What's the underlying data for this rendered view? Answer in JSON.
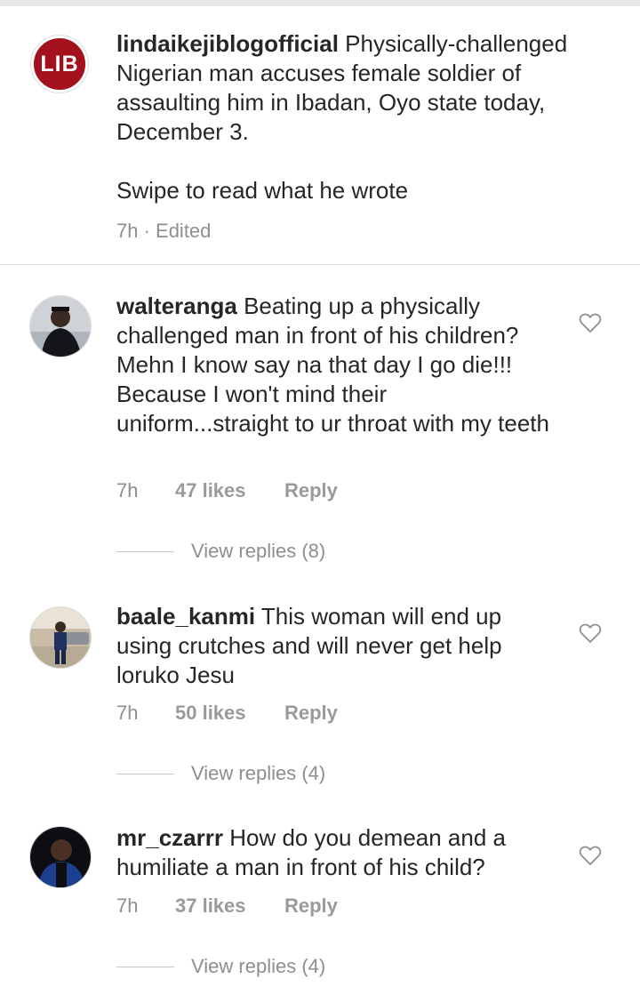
{
  "caption": {
    "avatar_text": "LIB",
    "username": "lindaikejiblogofficial",
    "text": "Physically-challenged Nigerian man accuses female soldier of assaulting him in Ibadan, Oyo state today, December 3.",
    "text2": "Swipe to read what he wrote",
    "meta": "7h · Edited"
  },
  "comments": [
    {
      "username": "walteranga",
      "text": "Beating up a physically challenged man in front of his children? Mehn I know say na that day I go die!!! Because I won't mind their uniform...straight to ur throat with my teeth",
      "time": "7h",
      "likes": "47 likes",
      "reply": "Reply",
      "view_replies": "View replies (8)"
    },
    {
      "username": "baale_kanmi",
      "text": "This woman will end up using crutches and will never get help loruko Jesu",
      "time": "7h",
      "likes": "50 likes",
      "reply": "Reply",
      "view_replies": "View replies (4)"
    },
    {
      "username": "mr_czarrr",
      "text": "How do you demean and a humiliate a man in front of his child?",
      "time": "7h",
      "likes": "37 likes",
      "reply": "Reply",
      "view_replies": "View replies (4)"
    }
  ],
  "colors": {
    "text": "#262626",
    "muted": "#8e8e8e",
    "brand_red": "#a3111c",
    "divider": "#dbdbdb"
  },
  "icons": [
    "heart-icon"
  ]
}
